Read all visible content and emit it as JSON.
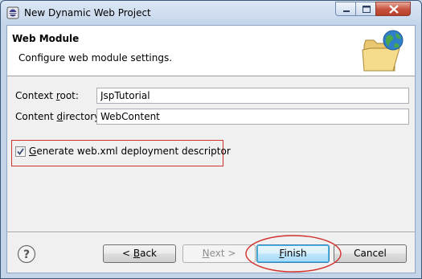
{
  "window": {
    "title": "New Dynamic Web Project"
  },
  "banner": {
    "title": "Web Module",
    "description": "Configure web module settings.",
    "icon": "folder-globe-icon"
  },
  "fields": {
    "context_root": {
      "label_pre": "Context ",
      "label_mn": "r",
      "label_post": "oot:",
      "value": "JspTutorial"
    },
    "content_directory": {
      "label_pre": "Content ",
      "label_mn": "d",
      "label_post": "irectory:",
      "value": "WebContent"
    }
  },
  "generate_descriptor": {
    "label_mn": "G",
    "label_rest": "enerate web.xml deployment descriptor",
    "checked": true
  },
  "buttons": {
    "back": {
      "pre": "< ",
      "mn": "B",
      "post": "ack"
    },
    "next": {
      "pre": "",
      "mn": "N",
      "post": "ext >"
    },
    "finish": {
      "pre": "",
      "mn": "F",
      "post": "inish"
    },
    "cancel": {
      "pre": "Cancel",
      "mn": "",
      "post": ""
    }
  },
  "colors": {
    "annotation_red": "#d0312d",
    "default_button_border": "#3c7fb1"
  }
}
